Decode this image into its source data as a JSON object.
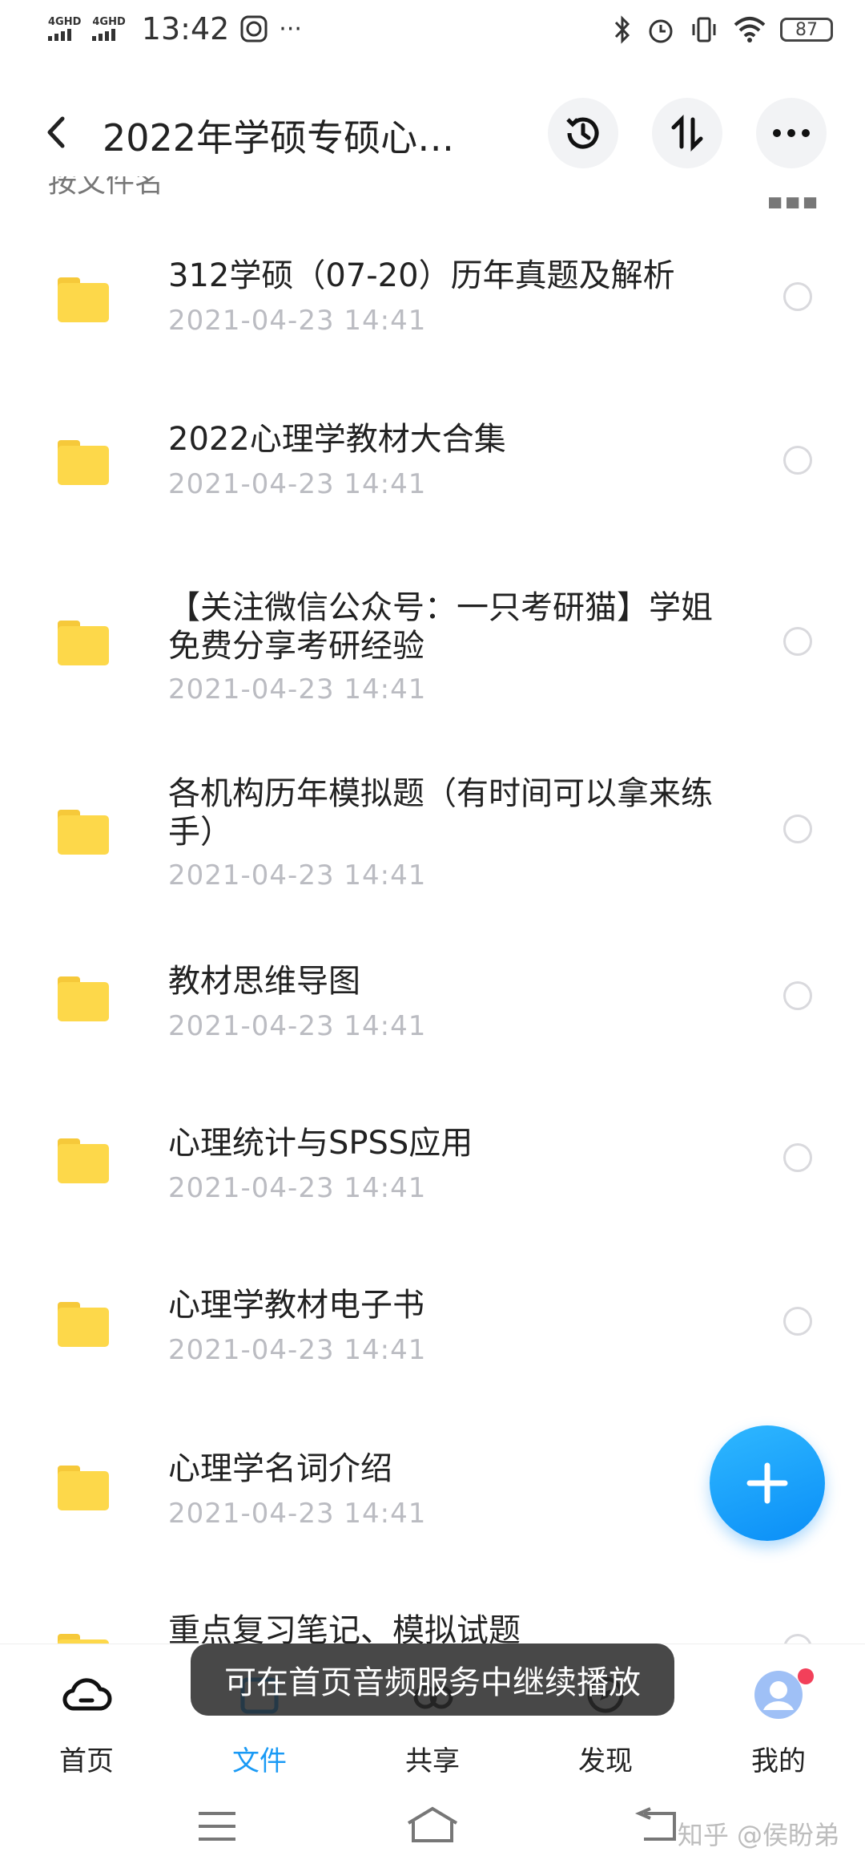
{
  "status_bar": {
    "signal1": "4GHD",
    "signal2": "4GHD",
    "time": "13:42",
    "more": "···",
    "battery": "87"
  },
  "header": {
    "title": "2022年学硕专硕心…"
  },
  "sort": {
    "label": "按文件名"
  },
  "files": [
    {
      "name": "312学硕（07-20）历年真题及解析",
      "date": "2021-04-23  14:41"
    },
    {
      "name": "2022心理学教材大合集",
      "date": "2021-04-23  14:41"
    },
    {
      "name": "【关注微信公众号：一只考研猫】学姐免费分享考研经验",
      "date": "2021-04-23  14:41"
    },
    {
      "name": "各机构历年模拟题（有时间可以拿来练手）",
      "date": "2021-04-23  14:41"
    },
    {
      "name": "教材思维导图",
      "date": "2021-04-23  14:41"
    },
    {
      "name": "心理统计与SPSS应用",
      "date": "2021-04-23  14:41"
    },
    {
      "name": "心理学教材电子书",
      "date": "2021-04-23  14:41"
    },
    {
      "name": "心理学名词介绍",
      "date": "2021-04-23  14:41"
    },
    {
      "name": "重点复习笔记、模拟试题",
      "date": ""
    }
  ],
  "toast": "可在首页音频服务中继续播放",
  "bottom_nav": [
    {
      "label": "首页"
    },
    {
      "label": "文件"
    },
    {
      "label": "共享"
    },
    {
      "label": "发现"
    },
    {
      "label": "我的"
    }
  ],
  "watermark": "知乎 @侯盼弟",
  "colors": {
    "accent": "#1a9af5",
    "folder": "#fdd84a",
    "date": "#bbbcc2"
  }
}
